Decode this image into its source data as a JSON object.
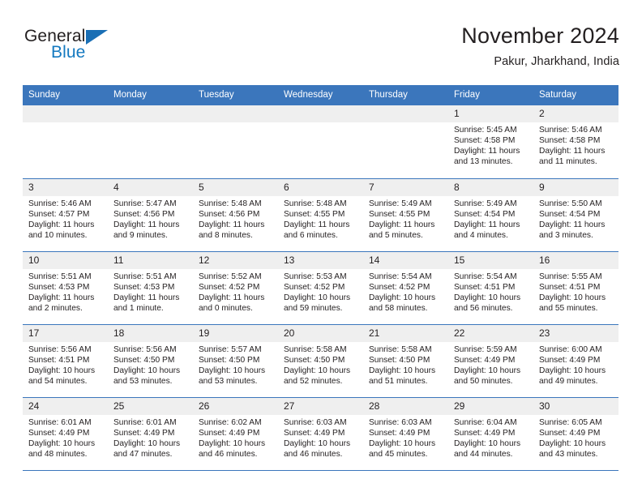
{
  "brand": {
    "name_top": "General",
    "name_bottom": "Blue",
    "accent_color": "#1479c0",
    "triangle_color": "#1a6fb5"
  },
  "header": {
    "title": "November 2024",
    "subtitle": "Pakur, Jharkhand, India"
  },
  "theme": {
    "header_blue": "#3b76bc",
    "daynum_band": "#efefef",
    "text": "#231f20"
  },
  "weekday_headers": [
    "Sunday",
    "Monday",
    "Tuesday",
    "Wednesday",
    "Thursday",
    "Friday",
    "Saturday"
  ],
  "weeks": [
    [
      {
        "day": "",
        "sunrise": "",
        "sunset": "",
        "daylight1": "",
        "daylight2": ""
      },
      {
        "day": "",
        "sunrise": "",
        "sunset": "",
        "daylight1": "",
        "daylight2": ""
      },
      {
        "day": "",
        "sunrise": "",
        "sunset": "",
        "daylight1": "",
        "daylight2": ""
      },
      {
        "day": "",
        "sunrise": "",
        "sunset": "",
        "daylight1": "",
        "daylight2": ""
      },
      {
        "day": "",
        "sunrise": "",
        "sunset": "",
        "daylight1": "",
        "daylight2": ""
      },
      {
        "day": "1",
        "sunrise": "Sunrise: 5:45 AM",
        "sunset": "Sunset: 4:58 PM",
        "daylight1": "Daylight: 11 hours",
        "daylight2": "and 13 minutes."
      },
      {
        "day": "2",
        "sunrise": "Sunrise: 5:46 AM",
        "sunset": "Sunset: 4:58 PM",
        "daylight1": "Daylight: 11 hours",
        "daylight2": "and 11 minutes."
      }
    ],
    [
      {
        "day": "3",
        "sunrise": "Sunrise: 5:46 AM",
        "sunset": "Sunset: 4:57 PM",
        "daylight1": "Daylight: 11 hours",
        "daylight2": "and 10 minutes."
      },
      {
        "day": "4",
        "sunrise": "Sunrise: 5:47 AM",
        "sunset": "Sunset: 4:56 PM",
        "daylight1": "Daylight: 11 hours",
        "daylight2": "and 9 minutes."
      },
      {
        "day": "5",
        "sunrise": "Sunrise: 5:48 AM",
        "sunset": "Sunset: 4:56 PM",
        "daylight1": "Daylight: 11 hours",
        "daylight2": "and 8 minutes."
      },
      {
        "day": "6",
        "sunrise": "Sunrise: 5:48 AM",
        "sunset": "Sunset: 4:55 PM",
        "daylight1": "Daylight: 11 hours",
        "daylight2": "and 6 minutes."
      },
      {
        "day": "7",
        "sunrise": "Sunrise: 5:49 AM",
        "sunset": "Sunset: 4:55 PM",
        "daylight1": "Daylight: 11 hours",
        "daylight2": "and 5 minutes."
      },
      {
        "day": "8",
        "sunrise": "Sunrise: 5:49 AM",
        "sunset": "Sunset: 4:54 PM",
        "daylight1": "Daylight: 11 hours",
        "daylight2": "and 4 minutes."
      },
      {
        "day": "9",
        "sunrise": "Sunrise: 5:50 AM",
        "sunset": "Sunset: 4:54 PM",
        "daylight1": "Daylight: 11 hours",
        "daylight2": "and 3 minutes."
      }
    ],
    [
      {
        "day": "10",
        "sunrise": "Sunrise: 5:51 AM",
        "sunset": "Sunset: 4:53 PM",
        "daylight1": "Daylight: 11 hours",
        "daylight2": "and 2 minutes."
      },
      {
        "day": "11",
        "sunrise": "Sunrise: 5:51 AM",
        "sunset": "Sunset: 4:53 PM",
        "daylight1": "Daylight: 11 hours",
        "daylight2": "and 1 minute."
      },
      {
        "day": "12",
        "sunrise": "Sunrise: 5:52 AM",
        "sunset": "Sunset: 4:52 PM",
        "daylight1": "Daylight: 11 hours",
        "daylight2": "and 0 minutes."
      },
      {
        "day": "13",
        "sunrise": "Sunrise: 5:53 AM",
        "sunset": "Sunset: 4:52 PM",
        "daylight1": "Daylight: 10 hours",
        "daylight2": "and 59 minutes."
      },
      {
        "day": "14",
        "sunrise": "Sunrise: 5:54 AM",
        "sunset": "Sunset: 4:52 PM",
        "daylight1": "Daylight: 10 hours",
        "daylight2": "and 58 minutes."
      },
      {
        "day": "15",
        "sunrise": "Sunrise: 5:54 AM",
        "sunset": "Sunset: 4:51 PM",
        "daylight1": "Daylight: 10 hours",
        "daylight2": "and 56 minutes."
      },
      {
        "day": "16",
        "sunrise": "Sunrise: 5:55 AM",
        "sunset": "Sunset: 4:51 PM",
        "daylight1": "Daylight: 10 hours",
        "daylight2": "and 55 minutes."
      }
    ],
    [
      {
        "day": "17",
        "sunrise": "Sunrise: 5:56 AM",
        "sunset": "Sunset: 4:51 PM",
        "daylight1": "Daylight: 10 hours",
        "daylight2": "and 54 minutes."
      },
      {
        "day": "18",
        "sunrise": "Sunrise: 5:56 AM",
        "sunset": "Sunset: 4:50 PM",
        "daylight1": "Daylight: 10 hours",
        "daylight2": "and 53 minutes."
      },
      {
        "day": "19",
        "sunrise": "Sunrise: 5:57 AM",
        "sunset": "Sunset: 4:50 PM",
        "daylight1": "Daylight: 10 hours",
        "daylight2": "and 53 minutes."
      },
      {
        "day": "20",
        "sunrise": "Sunrise: 5:58 AM",
        "sunset": "Sunset: 4:50 PM",
        "daylight1": "Daylight: 10 hours",
        "daylight2": "and 52 minutes."
      },
      {
        "day": "21",
        "sunrise": "Sunrise: 5:58 AM",
        "sunset": "Sunset: 4:50 PM",
        "daylight1": "Daylight: 10 hours",
        "daylight2": "and 51 minutes."
      },
      {
        "day": "22",
        "sunrise": "Sunrise: 5:59 AM",
        "sunset": "Sunset: 4:49 PM",
        "daylight1": "Daylight: 10 hours",
        "daylight2": "and 50 minutes."
      },
      {
        "day": "23",
        "sunrise": "Sunrise: 6:00 AM",
        "sunset": "Sunset: 4:49 PM",
        "daylight1": "Daylight: 10 hours",
        "daylight2": "and 49 minutes."
      }
    ],
    [
      {
        "day": "24",
        "sunrise": "Sunrise: 6:01 AM",
        "sunset": "Sunset: 4:49 PM",
        "daylight1": "Daylight: 10 hours",
        "daylight2": "and 48 minutes."
      },
      {
        "day": "25",
        "sunrise": "Sunrise: 6:01 AM",
        "sunset": "Sunset: 4:49 PM",
        "daylight1": "Daylight: 10 hours",
        "daylight2": "and 47 minutes."
      },
      {
        "day": "26",
        "sunrise": "Sunrise: 6:02 AM",
        "sunset": "Sunset: 4:49 PM",
        "daylight1": "Daylight: 10 hours",
        "daylight2": "and 46 minutes."
      },
      {
        "day": "27",
        "sunrise": "Sunrise: 6:03 AM",
        "sunset": "Sunset: 4:49 PM",
        "daylight1": "Daylight: 10 hours",
        "daylight2": "and 46 minutes."
      },
      {
        "day": "28",
        "sunrise": "Sunrise: 6:03 AM",
        "sunset": "Sunset: 4:49 PM",
        "daylight1": "Daylight: 10 hours",
        "daylight2": "and 45 minutes."
      },
      {
        "day": "29",
        "sunrise": "Sunrise: 6:04 AM",
        "sunset": "Sunset: 4:49 PM",
        "daylight1": "Daylight: 10 hours",
        "daylight2": "and 44 minutes."
      },
      {
        "day": "30",
        "sunrise": "Sunrise: 6:05 AM",
        "sunset": "Sunset: 4:49 PM",
        "daylight1": "Daylight: 10 hours",
        "daylight2": "and 43 minutes."
      }
    ]
  ]
}
